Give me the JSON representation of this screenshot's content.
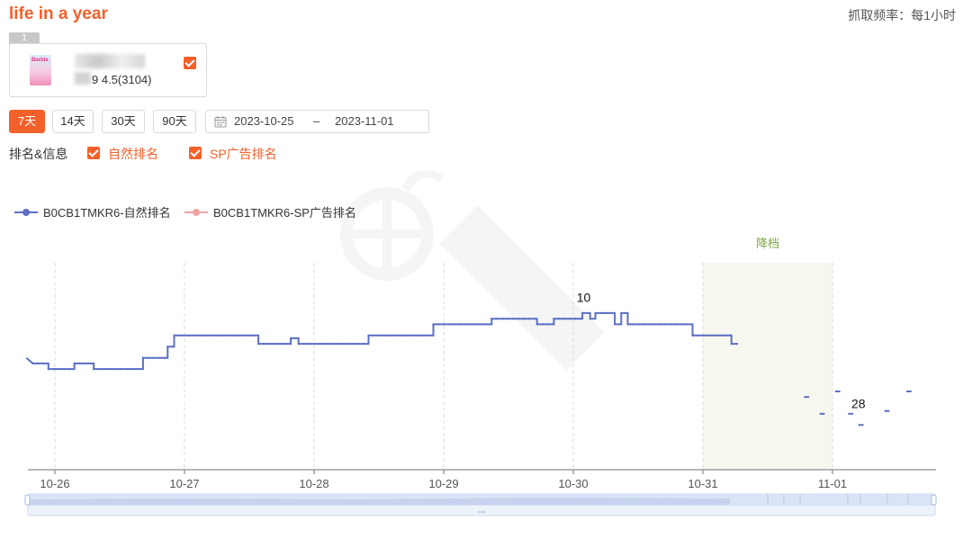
{
  "header": {
    "title": "life in a year",
    "frequency": "抓取频率：每1小时"
  },
  "product_card": {
    "index": "1",
    "rating_reviews": "9 4.5(3104)",
    "cover_label": "Barbie"
  },
  "range_buttons": [
    {
      "label": "7天",
      "active": true
    },
    {
      "label": "14天",
      "active": false
    },
    {
      "label": "30天",
      "active": false
    },
    {
      "label": "90天",
      "active": false
    }
  ],
  "date_range": {
    "start": "2023-10-25",
    "separator": "–",
    "end": "2023-11-01"
  },
  "options": {
    "label": "排名&信息",
    "organic": "自然排名",
    "sp": "SP广告排名"
  },
  "colors": {
    "accent": "#f4602a",
    "organic_series": "#5b6fc4",
    "sp_series": "#f0a3a3",
    "shaded_region": "#f6f7ef",
    "shaded_label": "#7ca846"
  },
  "chart_data": {
    "type": "line",
    "x_tick_labels": [
      "10-26",
      "10-27",
      "10-28",
      "10-29",
      "10-30",
      "10-31",
      "11-01"
    ],
    "x_range_days": [
      -0.22,
      6.77
    ],
    "y_inverted": true,
    "y_range": [
      3,
      40
    ],
    "grid": "vertical-dashed",
    "legend_position": "top-left",
    "series": [
      {
        "name": "B0CB1TMKR6-自然排名",
        "color": "#5b6fc4",
        "points": [
          [
            -0.22,
            20
          ],
          [
            -0.17,
            21
          ],
          [
            -0.05,
            21
          ],
          [
            -0.05,
            22
          ],
          [
            0.15,
            22
          ],
          [
            0.15,
            21
          ],
          [
            0.3,
            21
          ],
          [
            0.3,
            22
          ],
          [
            0.68,
            22
          ],
          [
            0.68,
            20
          ],
          [
            0.87,
            20
          ],
          [
            0.87,
            18
          ],
          [
            0.92,
            18
          ],
          [
            0.92,
            16
          ],
          [
            1.57,
            16
          ],
          [
            1.57,
            17.5
          ],
          [
            1.82,
            17.5
          ],
          [
            1.82,
            16.5
          ],
          [
            1.88,
            16.5
          ],
          [
            1.88,
            17.5
          ],
          [
            2.42,
            17.5
          ],
          [
            2.42,
            16
          ],
          [
            2.92,
            16
          ],
          [
            2.92,
            14
          ],
          [
            3.37,
            14
          ],
          [
            3.37,
            13
          ],
          [
            3.72,
            13
          ],
          [
            3.72,
            14
          ],
          [
            3.85,
            14
          ],
          [
            3.85,
            13
          ],
          [
            4.07,
            13
          ],
          [
            4.07,
            12
          ],
          [
            4.13,
            12
          ],
          [
            4.13,
            13
          ],
          [
            4.17,
            13
          ],
          [
            4.17,
            12
          ],
          [
            4.32,
            12
          ],
          [
            4.32,
            14
          ],
          [
            4.37,
            14
          ],
          [
            4.37,
            12
          ],
          [
            4.42,
            12
          ],
          [
            4.42,
            14
          ],
          [
            4.92,
            14
          ],
          [
            4.92,
            16
          ],
          [
            5.22,
            16
          ],
          [
            5.22,
            17.5
          ],
          [
            5.27,
            17.5
          ]
        ],
        "segments": [
          [
            [
              5.78,
              27
            ],
            [
              5.82,
              27
            ]
          ],
          [
            [
              5.9,
              30
            ],
            [
              5.94,
              30
            ]
          ],
          [
            [
              6.02,
              26
            ],
            [
              6.06,
              26
            ]
          ],
          [
            [
              6.12,
              30
            ],
            [
              6.16,
              30
            ]
          ],
          [
            [
              6.2,
              32
            ],
            [
              6.24,
              32
            ]
          ],
          [
            [
              6.4,
              29.5
            ],
            [
              6.44,
              29.5
            ]
          ],
          [
            [
              6.57,
              26
            ],
            [
              6.61,
              26
            ]
          ]
        ]
      },
      {
        "name": "B0CB1TMKR6-SP广告排名",
        "color": "#f0a3a3",
        "points": []
      }
    ],
    "annotations": [
      {
        "text": "10",
        "x": 4.08,
        "y": 10
      },
      {
        "text": "28",
        "x": 6.2,
        "y": 29
      }
    ],
    "shaded_region": {
      "label": "降档",
      "x_start": 5.0,
      "x_end": 6.0
    }
  }
}
